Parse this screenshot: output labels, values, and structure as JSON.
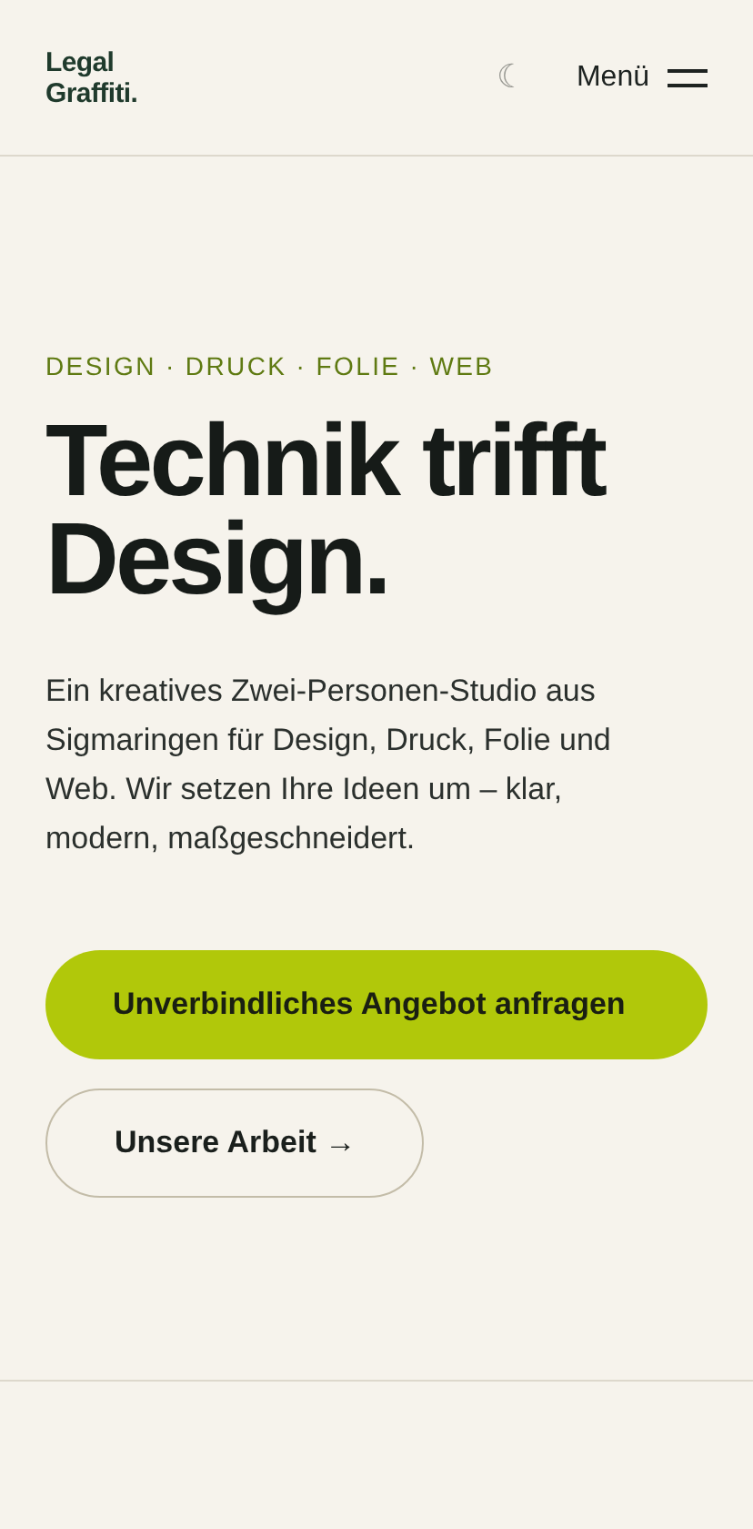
{
  "header": {
    "logo_lines": [
      "Legal",
      "Graffiti."
    ],
    "theme_toggle": "☾",
    "menu_label": "Menü"
  },
  "hero": {
    "eyebrow": "DESIGN · DRUCK · FOLIE · WEB",
    "title": "Technik trifft Design.",
    "text": "Ein kreatives Zwei-Personen-Studio aus Sigmaringen für Design, Druck, Folie und Web. Wir setzen Ihre Ideen um – klar, modern, maßgeschneidert.",
    "buttons": [
      {
        "label": "Unverbindliches Angebot anfragen",
        "kind": "primary"
      },
      {
        "label": "Unsere Arbeit →",
        "kind": "secondary"
      }
    ]
  }
}
